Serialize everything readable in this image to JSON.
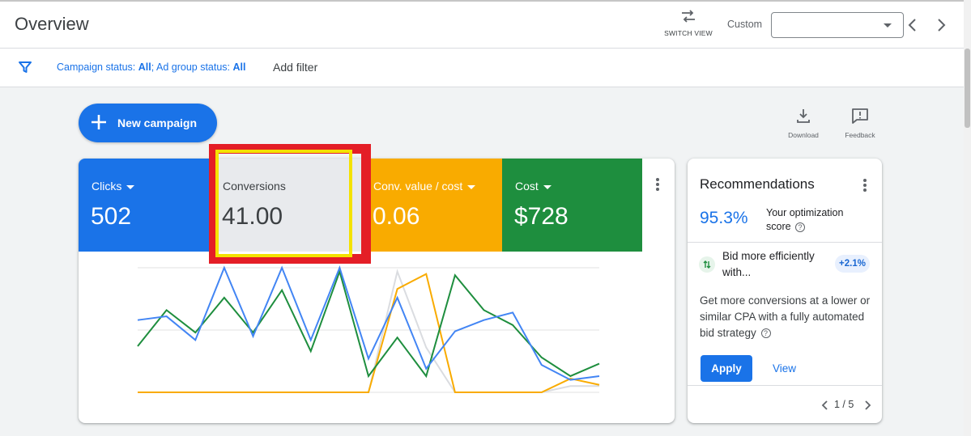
{
  "header": {
    "title": "Overview",
    "switch_view_label": "SWITCH VIEW",
    "date_range_label": "Custom",
    "date_range_value": ""
  },
  "filter_bar": {
    "campaign_status_label": "Campaign status:",
    "campaign_status_value": "All",
    "ad_group_status_label": "; Ad group status:",
    "ad_group_status_value": "All",
    "add_filter_label": "Add filter"
  },
  "actions": {
    "new_campaign_label": "New campaign",
    "download_label": "Download",
    "feedback_label": "Feedback"
  },
  "metrics": [
    {
      "label": "Clicks",
      "value": "502",
      "color": "#1a73e8",
      "selected": true
    },
    {
      "label": "Conversions",
      "value": "41.00",
      "color": "#e8eaed",
      "selected": false
    },
    {
      "label": "Conv. value / cost",
      "value": "0.06",
      "color": "#f9ab00",
      "selected": true
    },
    {
      "label": "Cost",
      "value": "$728",
      "color": "#1e8e3e",
      "selected": true
    }
  ],
  "chart_data": {
    "type": "line",
    "x": [
      0,
      1,
      2,
      3,
      4,
      5,
      6,
      7,
      8,
      9,
      10,
      11,
      12,
      13,
      14,
      15,
      16
    ],
    "grid": true,
    "series": [
      {
        "color": "#4285f4",
        "values": [
          0.58,
          0.61,
          0.42,
          1.0,
          0.45,
          1.0,
          0.42,
          1.0,
          0.27,
          0.76,
          0.19,
          0.49,
          0.58,
          0.64,
          0.22,
          0.1,
          0.13
        ]
      },
      {
        "color": "#1e8e3e",
        "values": [
          0.37,
          0.66,
          0.48,
          0.76,
          0.48,
          0.82,
          0.33,
          0.97,
          0.13,
          0.44,
          0.13,
          0.94,
          0.66,
          0.54,
          0.28,
          0.13,
          0.23
        ]
      },
      {
        "color": "#f9ab00",
        "values": [
          0.0,
          0.0,
          0.0,
          0.0,
          0.0,
          0.0,
          0.0,
          0.0,
          0.0,
          0.83,
          0.95,
          0.0,
          0.0,
          0.0,
          0.0,
          0.11,
          0.06
        ]
      },
      {
        "color": "#dadce0",
        "values": [
          0.0,
          0.0,
          0.0,
          0.0,
          0.0,
          0.0,
          0.0,
          0.0,
          0.0,
          0.97,
          0.36,
          0.0,
          0.0,
          0.0,
          0.0,
          0.05,
          0.05
        ]
      }
    ]
  },
  "recommendations": {
    "title": "Recommendations",
    "score": "95.3%",
    "score_label": "Your optimization score",
    "item_title": "Bid more efficiently with...",
    "item_badge": "+2.1%",
    "item_description": "Get more conversions at a lower or similar CPA with a fully automated bid strategy",
    "apply_label": "Apply",
    "view_label": "View",
    "pager": "1 / 5"
  }
}
